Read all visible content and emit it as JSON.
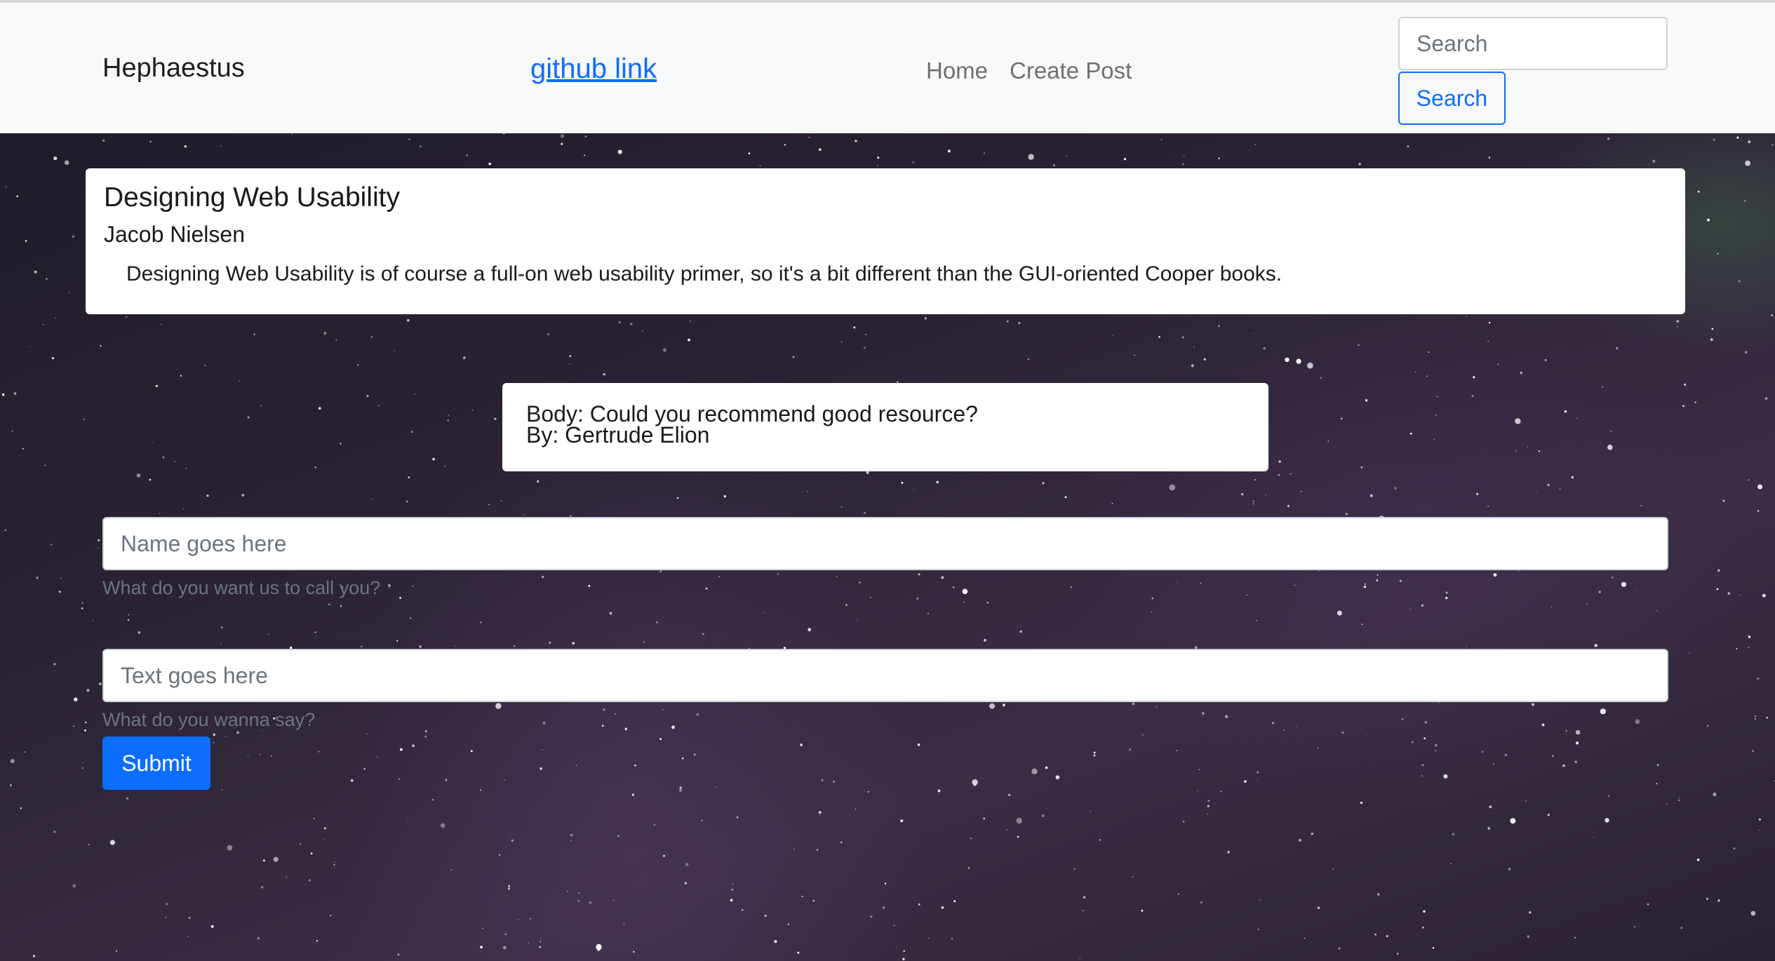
{
  "navbar": {
    "brand": "Hephaestus",
    "github_link_label": "github link",
    "nav_items": [
      "Home",
      "Create Post"
    ],
    "search_placeholder": "Search",
    "search_button_label": "Search"
  },
  "post": {
    "title": "Designing Web Usability",
    "author": "Jacob Nielsen",
    "body": "Designing Web Usability is of course a full-on web usability primer, so it's a bit different than the GUI-oriented Cooper books."
  },
  "comments": [
    {
      "body_line": "Body: Could you recommend good resource?",
      "by_line": "By: Gertrude Elion"
    }
  ],
  "comment_form": {
    "name_placeholder": "Name goes here",
    "name_help": "What do you want us to call you?",
    "text_placeholder": "Text goes here",
    "text_help": "What do you wanna say?",
    "submit_label": "Submit"
  },
  "colors": {
    "accent": "#0d6efd",
    "navbar_background": "#f8f9fa",
    "help_text": "#6c757d"
  }
}
